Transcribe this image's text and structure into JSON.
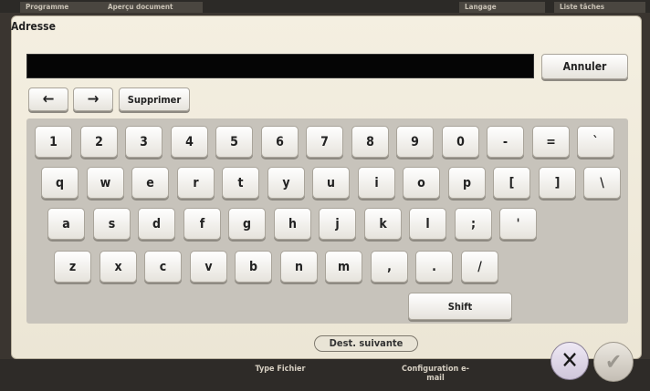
{
  "background": {
    "top_tabs": [
      "Programme",
      "Aperçu document",
      "Langage",
      "Liste tâches"
    ],
    "bottom_labels": [
      "Type Fichier",
      "Configuration e-mail"
    ]
  },
  "dialog": {
    "title": "Adresse",
    "address_value": "",
    "cancel_label": "Annuler",
    "arrow_left": "←",
    "arrow_right": "→",
    "delete_label": "Supprimer",
    "next_dest_label": "Dest. suivante",
    "close_glyph": "✕",
    "ok_glyph": "✔"
  },
  "keyboard": {
    "row1": [
      "1",
      "2",
      "3",
      "4",
      "5",
      "6",
      "7",
      "8",
      "9",
      "0",
      "-",
      "=",
      "`"
    ],
    "row2": [
      "q",
      "w",
      "e",
      "r",
      "t",
      "y",
      "u",
      "i",
      "o",
      "p",
      "[",
      "]",
      "\\"
    ],
    "row3": [
      "a",
      "s",
      "d",
      "f",
      "g",
      "h",
      "j",
      "k",
      "l",
      ";",
      "'"
    ],
    "row4": [
      "z",
      "x",
      "c",
      "v",
      "b",
      "n",
      "m",
      ",",
      ".",
      "/"
    ],
    "shift_label": "Shift"
  }
}
